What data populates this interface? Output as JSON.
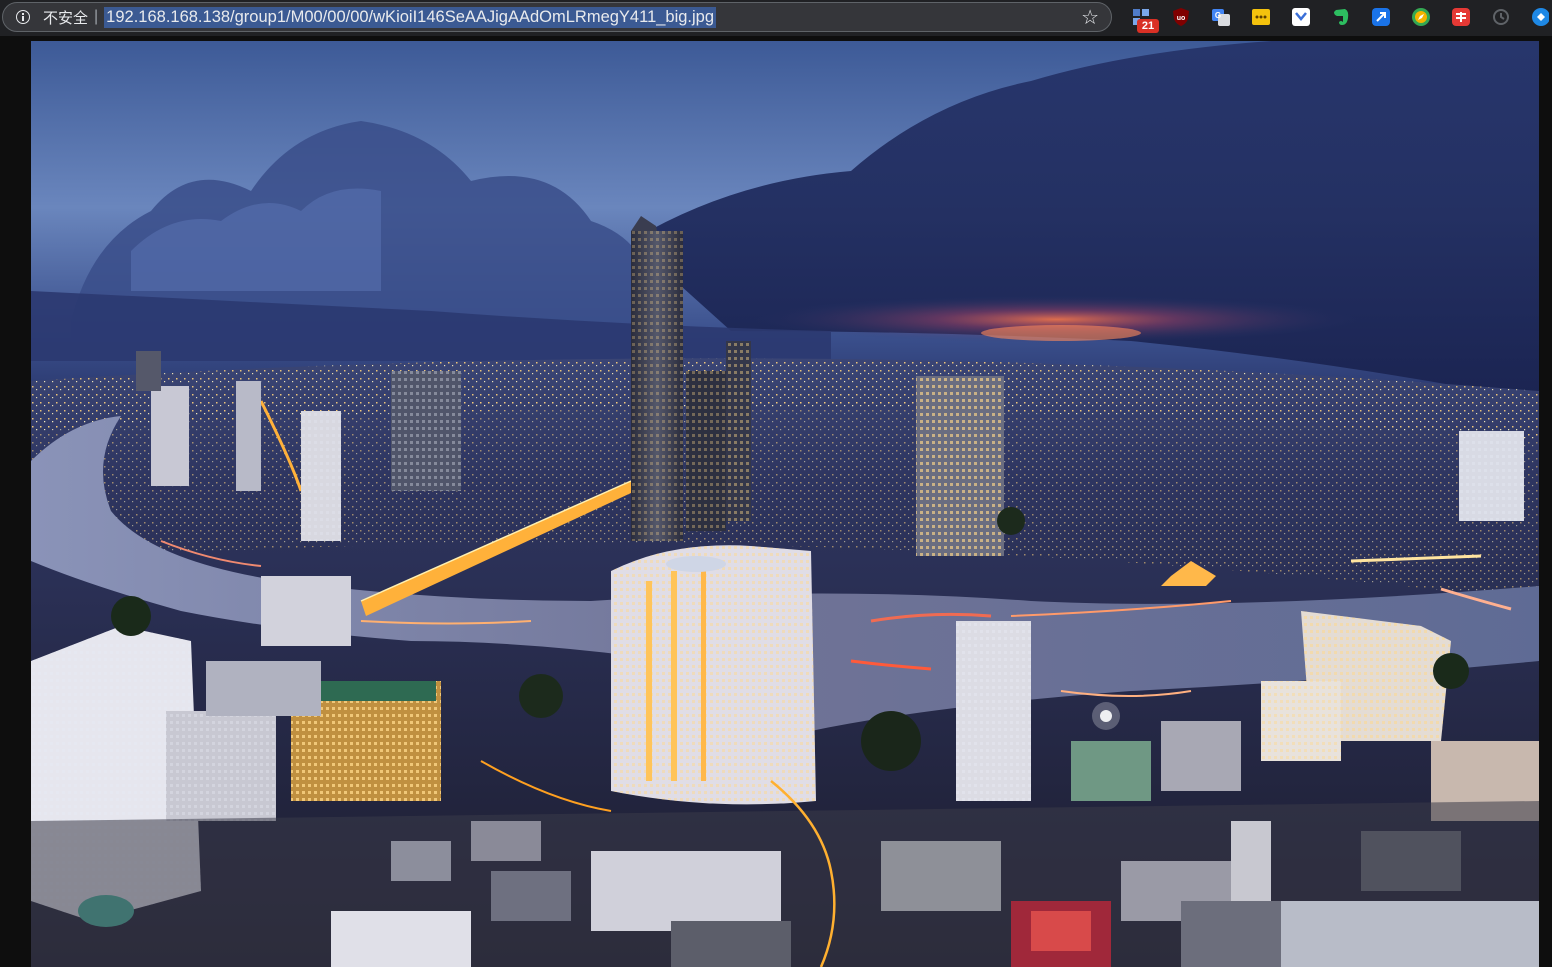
{
  "address_bar": {
    "security_label": "不安全",
    "url": "192.168.168.138/group1/M00/00/00/wKioiI146SeAAJigAAdOmLRmegY411_big.jpg"
  },
  "extensions": [
    {
      "name": "extensions-counter-icon",
      "color": "#4f7cc9",
      "badge": "21"
    },
    {
      "name": "ublock-icon",
      "color": "#800000"
    },
    {
      "name": "translate-icon",
      "color": "#4285f4"
    },
    {
      "name": "notes-icon",
      "color": "#f4c20d"
    },
    {
      "name": "pocket-icon",
      "color": "#ffffff"
    },
    {
      "name": "evernote-icon",
      "color": "#2dbe60"
    },
    {
      "name": "shortcut-icon",
      "color": "#1a73e8"
    },
    {
      "name": "compass-icon",
      "color": "#f4b400"
    },
    {
      "name": "red-app-icon",
      "color": "#e53935"
    },
    {
      "name": "sync-icon",
      "color": "#5f6368"
    },
    {
      "name": "blue-app-icon",
      "color": "#1e88e5"
    }
  ],
  "image": {
    "alt": "wKioiI146SeAAJigAAdOmLRmegY411_big.jpg"
  }
}
